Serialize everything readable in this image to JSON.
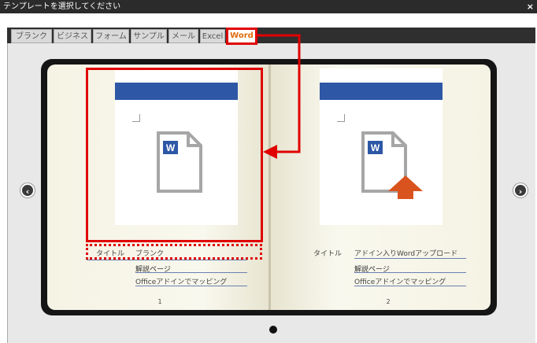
{
  "window": {
    "title": "テンプレートを選択してください",
    "close_label": "×"
  },
  "tabs": [
    {
      "label": "ブランク"
    },
    {
      "label": "ビジネス"
    },
    {
      "label": "フォーム"
    },
    {
      "label": "サンプル"
    },
    {
      "label": "メール"
    },
    {
      "label": "Excel"
    },
    {
      "label": "Word",
      "active": true
    }
  ],
  "templates": [
    {
      "title_label": "タイトル",
      "title": "ブランク",
      "link": "解説ページ",
      "description": "Officeアドインでマッピング",
      "page_number": "1",
      "icon": "word-document-icon"
    },
    {
      "title_label": "タイトル",
      "title": "アドイン入りWordアップロード",
      "link": "解説ページ",
      "description": "Officeアドインでマッピング",
      "page_number": "2",
      "icon": "word-document-upload-icon"
    }
  ],
  "nav": {
    "prev_label": "‹",
    "next_label": "›"
  },
  "colors": {
    "accent_red": "#e00000",
    "word_blue": "#2e58a6",
    "upload_orange": "#d9531e",
    "active_tab_text": "#e26b0a"
  }
}
